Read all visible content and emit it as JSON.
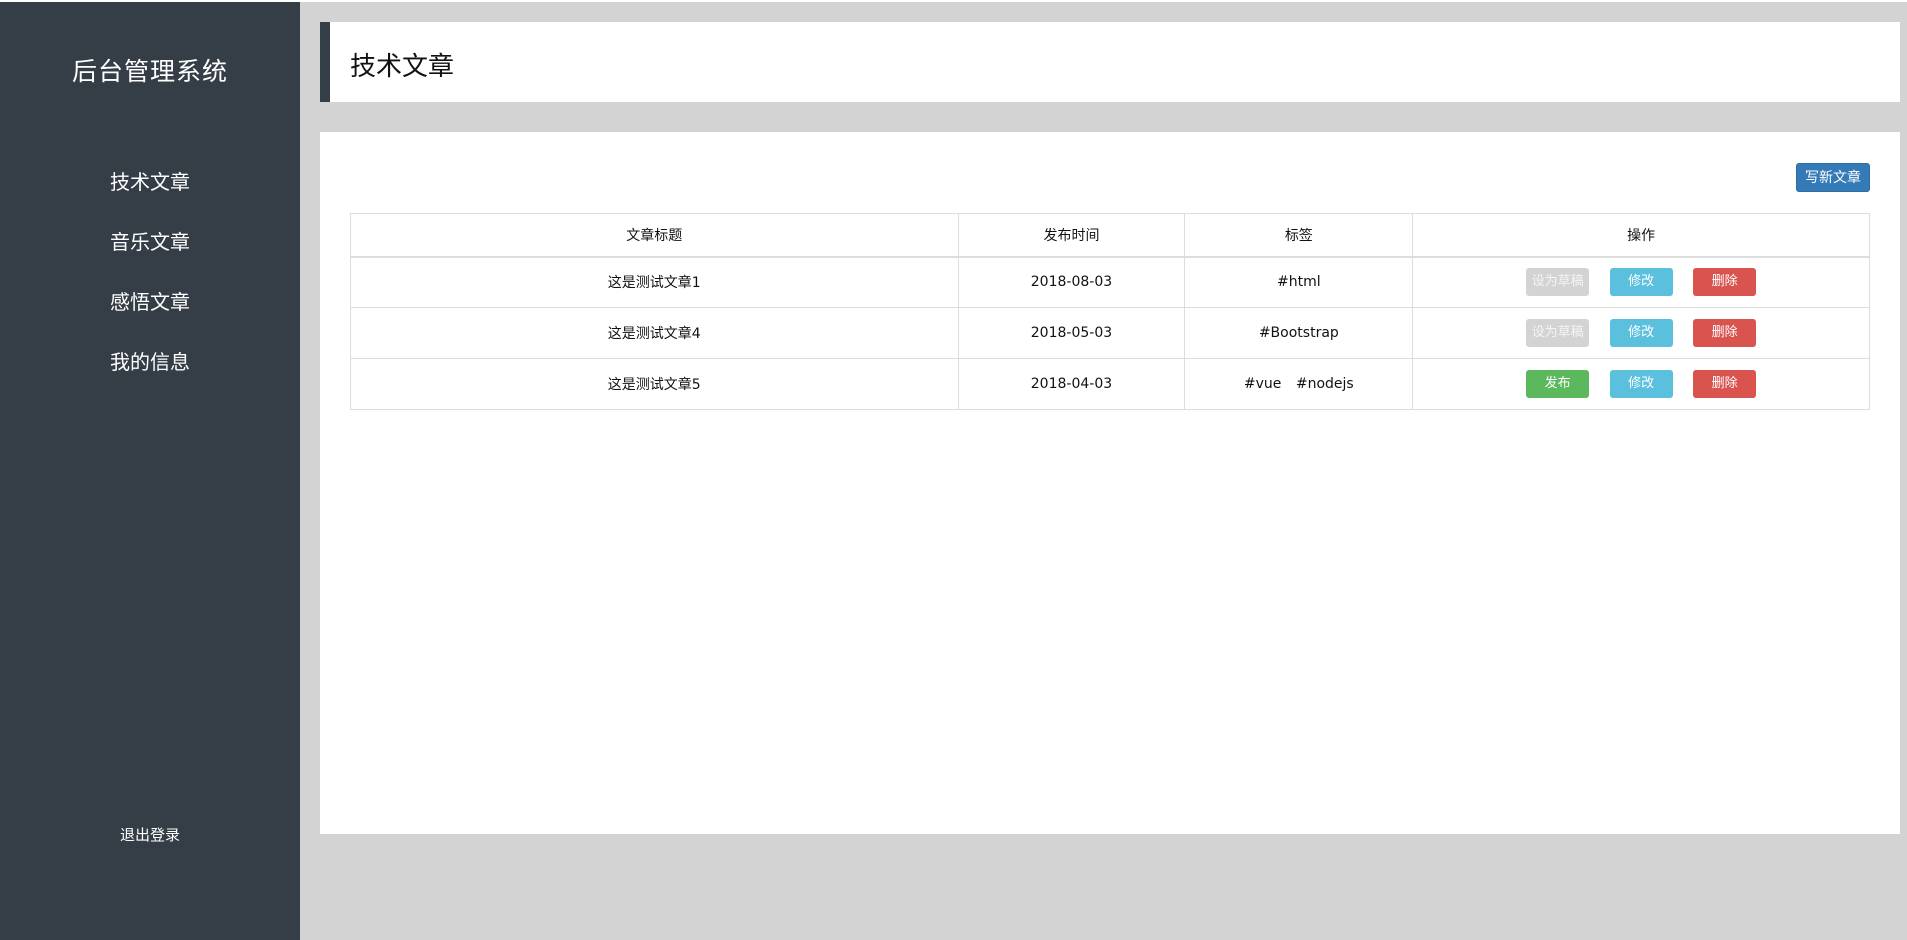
{
  "sidebar": {
    "brand": "后台管理系统",
    "items": [
      {
        "label": "技术文章"
      },
      {
        "label": "音乐文章"
      },
      {
        "label": "感悟文章"
      },
      {
        "label": "我的信息"
      }
    ],
    "logout_label": "退出登录"
  },
  "header": {
    "title": "技术文章"
  },
  "toolbar": {
    "new_label": "写新文章"
  },
  "table": {
    "headers": [
      "文章标题",
      "发布时间",
      "标签",
      "操作"
    ],
    "rows": [
      {
        "title": "这是测试文章1",
        "date": "2018-08-03",
        "tags": [
          "#html"
        ],
        "status_button": "设为草稿",
        "status_button_disabled": true,
        "edit_button": "修改",
        "delete_button": "删除"
      },
      {
        "title": "这是测试文章4",
        "date": "2018-05-03",
        "tags": [
          "#Bootstrap"
        ],
        "status_button": "设为草稿",
        "status_button_disabled": true,
        "edit_button": "修改",
        "delete_button": "删除"
      },
      {
        "title": "这是测试文章5",
        "date": "2018-04-03",
        "tags": [
          "#vue",
          "#nodejs"
        ],
        "status_button": "发布",
        "status_button_disabled": false,
        "edit_button": "修改",
        "delete_button": "删除"
      }
    ]
  },
  "colors": {
    "sidebar_bg": "#353d47",
    "page_bg": "#d3d3d3",
    "primary": "#337ab7",
    "success": "#5cb85c",
    "info": "#5bc0de",
    "danger": "#d9534f",
    "disabled": "#d3d3d3"
  }
}
